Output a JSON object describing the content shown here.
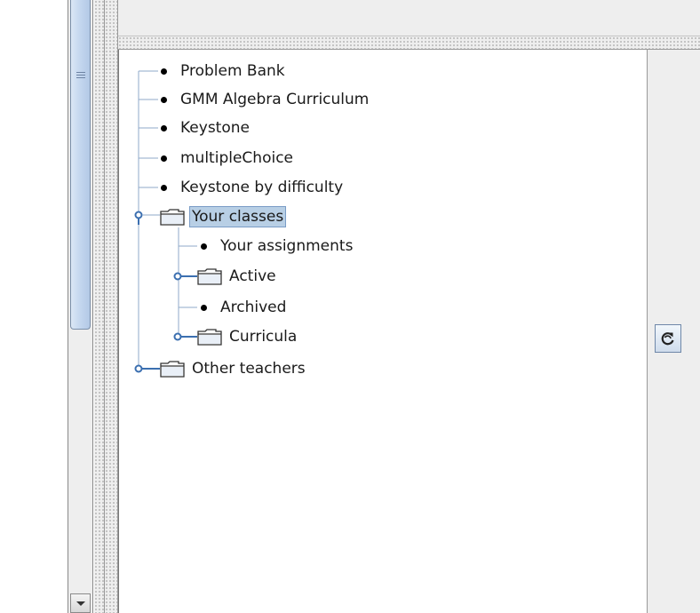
{
  "tree": {
    "items": [
      {
        "label": "Problem Bank",
        "type": "leaf",
        "depth": 1
      },
      {
        "label": "GMM Algebra Curriculum",
        "type": "leaf",
        "depth": 1
      },
      {
        "label": "Keystone",
        "type": "leaf",
        "depth": 1
      },
      {
        "label": "multipleChoice",
        "type": "leaf",
        "depth": 1
      },
      {
        "label": "Keystone by difficulty",
        "type": "leaf",
        "depth": 1
      },
      {
        "label": "Your classes",
        "type": "folder",
        "depth": 1,
        "expanded": true,
        "selected": true
      },
      {
        "label": "Your assignments",
        "type": "leaf",
        "depth": 2
      },
      {
        "label": "Active",
        "type": "folder",
        "depth": 2,
        "expanded": false
      },
      {
        "label": "Archived",
        "type": "leaf",
        "depth": 2
      },
      {
        "label": "Curricula",
        "type": "folder",
        "depth": 2,
        "expanded": false
      },
      {
        "label": "Other teachers",
        "type": "folder",
        "depth": 1,
        "expanded": false
      }
    ]
  },
  "toolbar": {
    "refresh_icon": "refresh-icon"
  },
  "colors": {
    "selection": "#b8cfe5",
    "tree_line": "#8fa8c8",
    "panel_bg": "#eeeeee"
  }
}
